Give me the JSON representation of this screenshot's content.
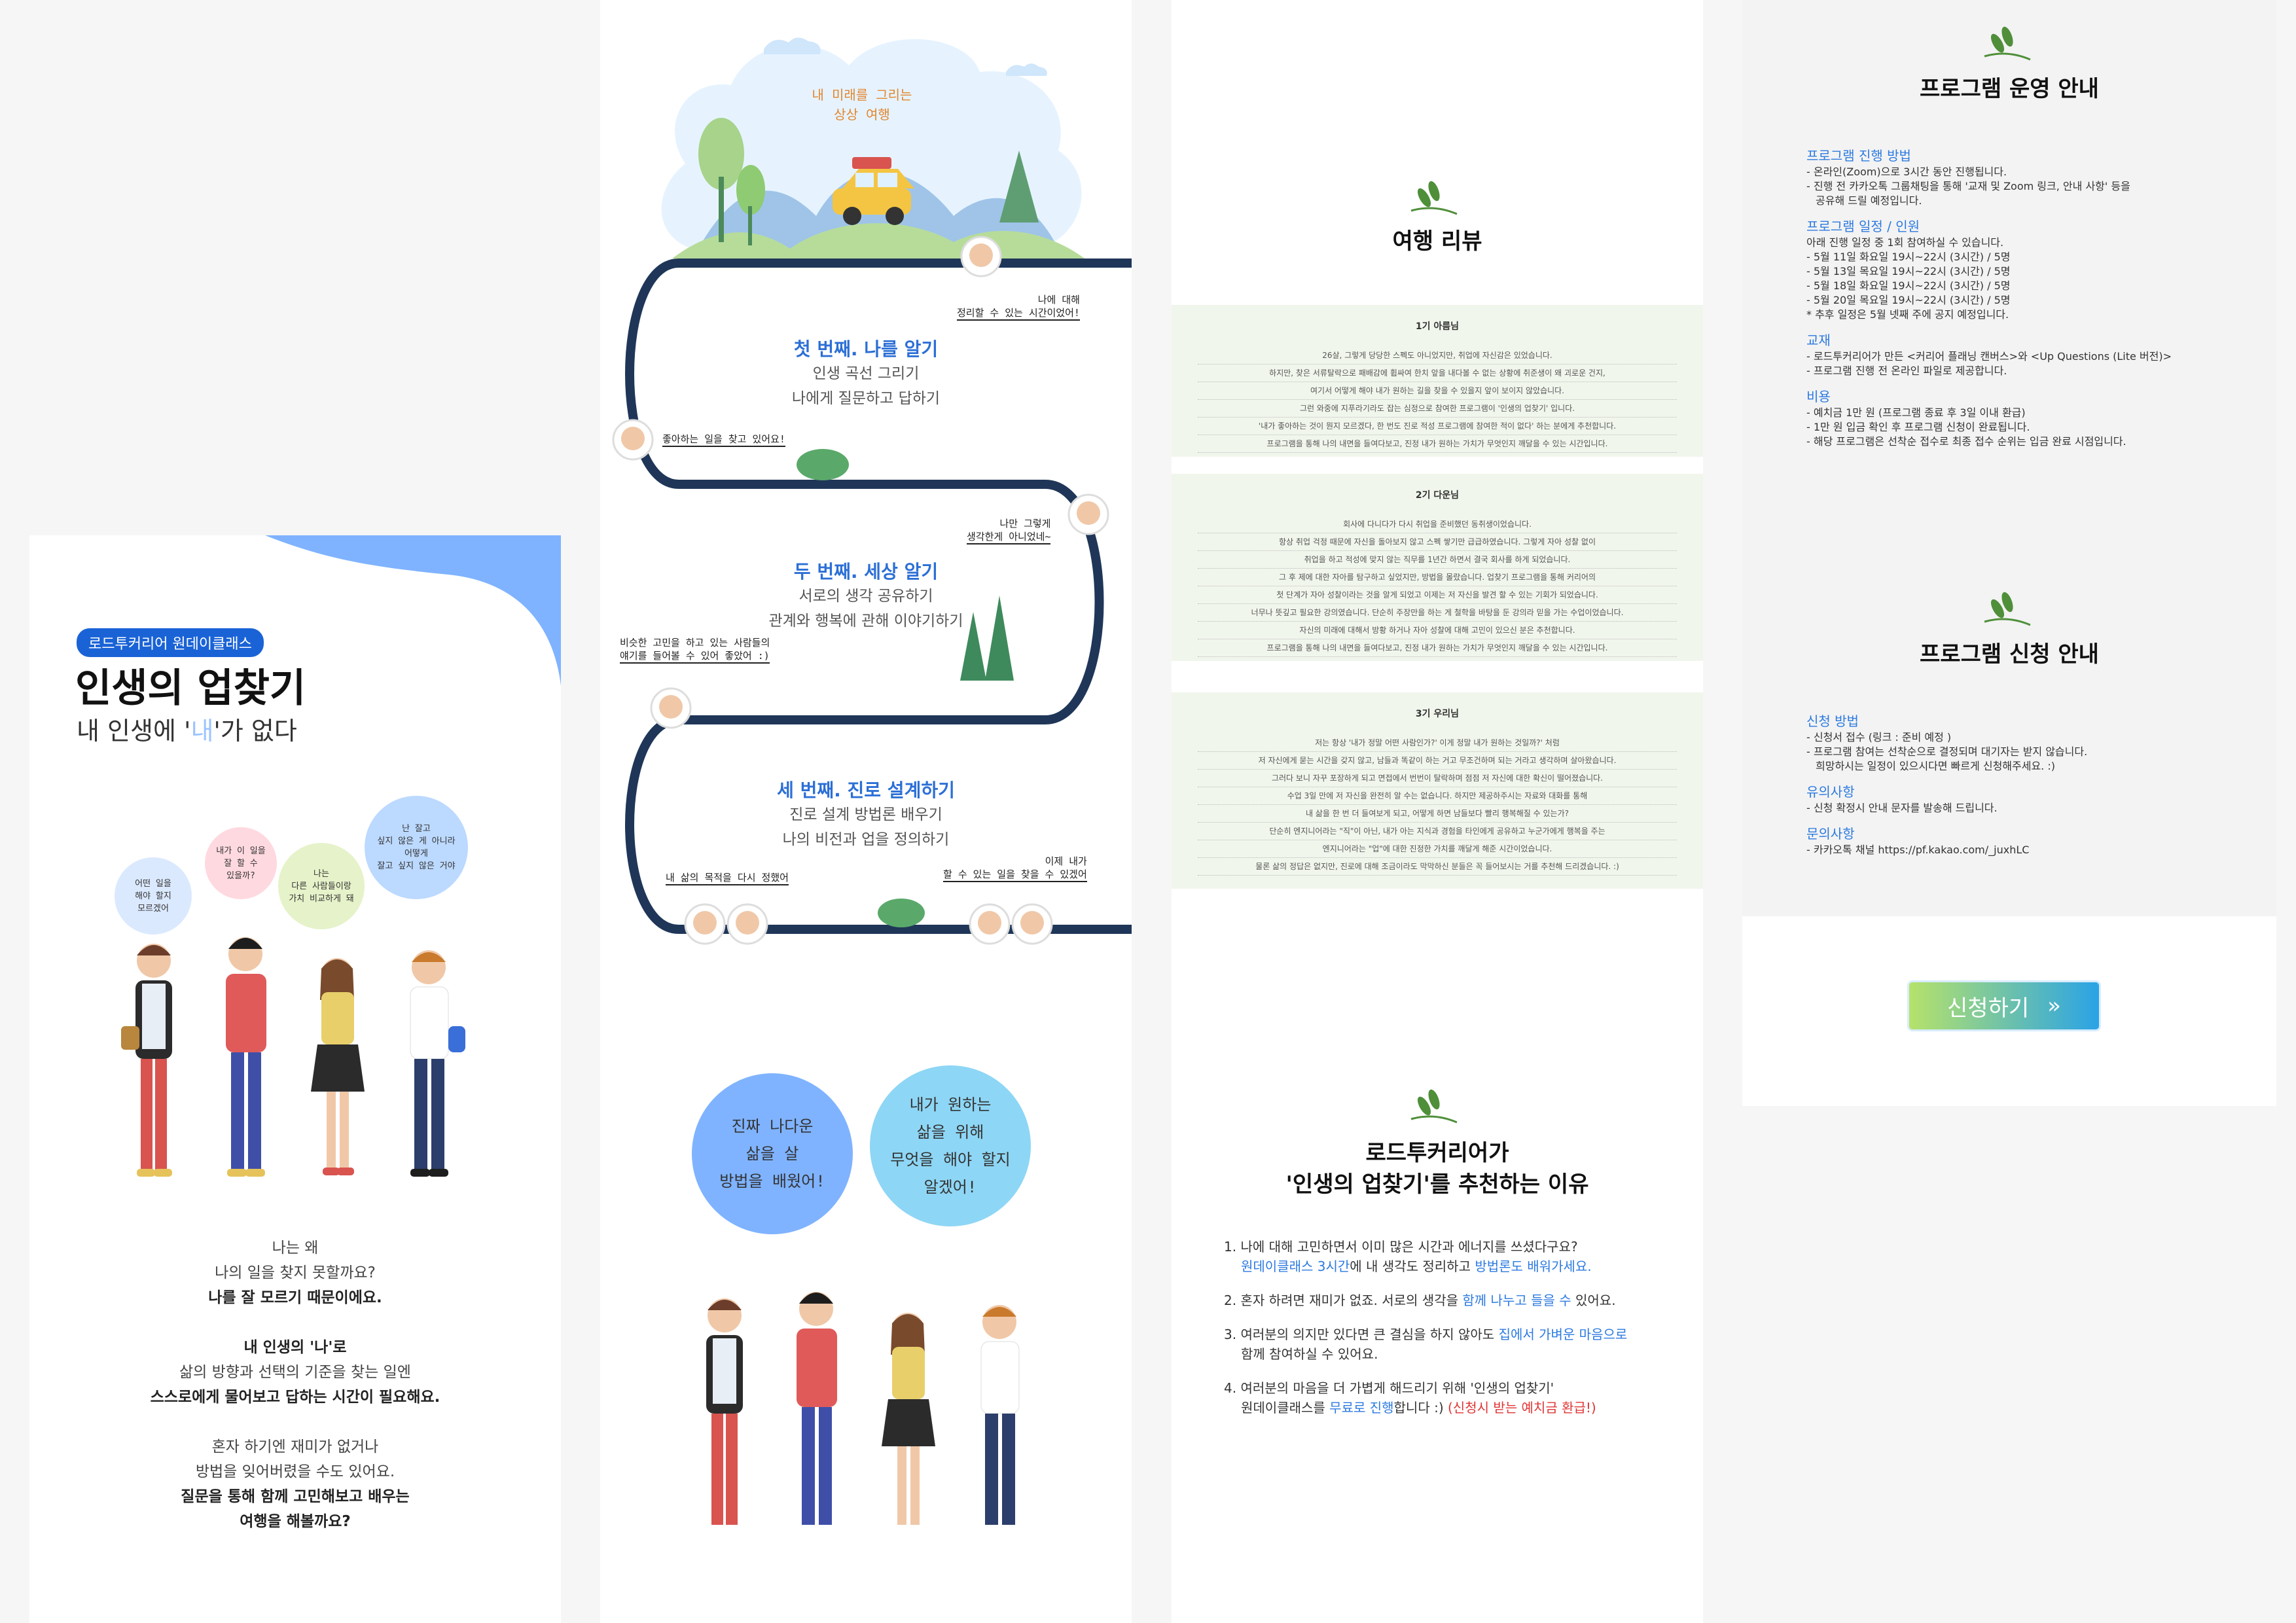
{
  "panel1": {
    "badge": "로드투커리어 원데이클래스",
    "title": "인생의 업찾기",
    "subtitle_before": "내 인생에 '",
    "subtitle_highlight": "내",
    "subtitle_after": "'가 없다",
    "bubbles": [
      "어떤 일을\n해야 할지\n모르겠어",
      "내가 이 일을\n잘 할 수\n있을까?",
      "나는\n다른 사람들이랑\n가치 비교하게 돼",
      "난 잘고\n싶지 않은 게 아니라\n어떻게\n잘고 싶지 않은 거야"
    ],
    "block1": [
      "나는 왜",
      "나의 일을 찾지 못할까요?"
    ],
    "block1_bold": "나를 잘 모르기 때문이에요.",
    "block2_bold": "내 인생의 '나'로",
    "block2": "삶의 방향과 선택의 기준을 찾는 일엔",
    "block2_bold2": "스스로에게 물어보고 답하는 시간이 필요해요.",
    "block3": [
      "혼자 하기엔 재미가 없거나",
      "방법을 잊어버렸을 수도 있어요."
    ],
    "block3_bold": [
      "질문을 통해 함께 고민해보고 배우는",
      "여행을 해볼까요?"
    ]
  },
  "panel2": {
    "cloud_title": "내 미래를 그리는\n상상 여행",
    "step1_title": "첫 번째. 나를 알기",
    "step1_lines": [
      "인생 곡선 그리기",
      "나에게 질문하고 답하기"
    ],
    "step2_title": "두 번째. 세상 알기",
    "step2_lines": [
      "서로의 생각 공유하기",
      "관계와 행복에 관해 이야기하기"
    ],
    "step3_title": "세 번째. 진로 설계하기",
    "step3_lines": [
      "진로 설계 방법론 배우기",
      "나의 비전과 업을 정의하기"
    ],
    "notes": [
      "나에 대해\n정리할 수 있는 시간이었어!",
      "좋아하는 일을 찾고 있어요!",
      "나만 그렇게\n생각한게 아니었네~",
      "비슷한 고민을 하고 있는 사람들의\n얘기를 들어볼 수 있어 좋았어 :)",
      "내 삶의 목적을 다시 정했어",
      "이제 내가\n할 수 있는 일을 찾을 수 있겠어"
    ],
    "bubble_left": "진짜 나다운\n삶을 살\n방법을 배웠어!",
    "bubble_right": "내가 원하는\n삶을 위해\n무엇을 해야 할지\n알겠어!"
  },
  "panel3": {
    "review_title": "여행 리뷰",
    "reviews": [
      {
        "name": "1기 아름님",
        "lines": [
          "26살, 그렇게 당당한 스펙도 아니었지만, 취업에 자신감은 있었습니다.",
          "하지만, 찾은 서류탈락으로 패배감에 휩싸여 한치 앞을 내다볼 수 없는 상황에 취준생이 왜 괴로운 건지,",
          "여기서 어떻게 해야 내가 원하는 길을 찾을 수 있을지 앞이 보이지 않았습니다.",
          "그런 와중에 지푸라기라도 잡는 심정으로 참여한 프로그램이 '인생의 업찾기' 입니다.",
          "'내가 좋아하는 것이 뭔지 모르겠다, 한 번도 진로 적성 프로그램에 참여한 적이 없다' 하는 분에게 추천합니다.",
          "프로그램을 통해 나의 내면을 들여다보고, 진정 내가 원하는 가치가 무엇인지 깨달을 수 있는 시간입니다."
        ]
      },
      {
        "name": "2기 다운님",
        "lines": [
          "회사에 다니다가 다시 취업을 준비했던 동취생이었습니다.",
          "항상 취업 걱정 때문에 자신을 돌아보지 않고 스펙 쌓기만 급급하였습니다. 그렇게 자아 성찰 없이",
          "취업을 하고 적성에 맞지 않는 직무를 1년간 하면서 결국 회사를 하게 되었습니다.",
          "그 후 제에 대한 자아를 탐구하고 싶었지만, 방법을 몰랐습니다. 업찾기 프로그램을 통해 커리어의",
          "첫 단계가 자아 성찰이라는 것을 알게 되었고 이제는 저 자신을 발견 할 수 있는 기회가 되었습니다.",
          "너무나 뜻깊고 필요한 강의였습니다. 단순히 주장만을 하는 게 철학을 바탕을 둔 강의라 믿을 가는 수업이었습니다.",
          "자신의 미래에 대해서 방황 하거나 자아 성찰에 대해 고민이 있으신 분은 추천합니다.",
          "프로그램을 통해 나의 내면을 들여다보고, 진정 내가 원하는 가치가 무엇인지 깨달을 수 있는 시간입니다."
        ]
      },
      {
        "name": "3기 우리님",
        "lines": [
          "저는 항상 '내가 정말 어떤 사람인가?' 이게 정말 내가 원하는 것일까?' 처럼",
          "저 자신에게 묻는 시간을 갖지 않고, 남들과 똑같이 하는 거고 무조건하며 되는 거라고 생각하며 살아왔습니다.",
          "그러다 보니 자꾸 포장하게 되고 면접에서 번번이 탈락하며 점점 저 자신에 대한 확신이 떨어졌습니다.",
          "수업 3일 만에 저 자신을 완전히 알 수는 없습니다. 하지만 제공하주시는 자료와 대화를 통해",
          "내 삶을 한 번 더 들여보게 되고, 어떻게 하면 남들보다 빨리 행복해질 수 있는가?",
          "단순히 엔지니어라는 \"직\"이 아닌, 내가 아는 지식과 경험을 타인에게 공유하고 누군가에게 행복을 주는",
          "엔지니어라는 \"업\"에 대한 진정한 가치를 깨달게 해준 시간이었습니다.",
          "물론 삶의 정답은 없지만, 진로에 대해 조금이라도 막막하신 분들은 꼭 들어보시는 거를 추천해 드리겠습니다. :)"
        ]
      }
    ],
    "recommend_title": "로드투커리어가\n'인생의 업찾기'를 추천하는 이유",
    "reasons": [
      {
        "num": "1.",
        "a": "나에 대해 고민하면서 이미 많은 시간과 에너지를 쓰셨다구요?",
        "b_blue": "원데이클래스 3시간",
        "b_mid": "에 내 생각도 정리하고 ",
        "b_blue2": "방법론도 배워가세요."
      },
      {
        "num": "2.",
        "a": "혼자 하려면 재미가 없죠. 서로의 생각을 ",
        "a_blue": "함께 나누고 들을 수",
        "a_end": " 있어요."
      },
      {
        "num": "3.",
        "a": "여러분의 의지만 있다면 큰 결심을 하지 않아도 ",
        "a_blue": "집에서 가벼운 마음으로",
        "b": "함께 참여하실 수 있어요."
      },
      {
        "num": "4.",
        "a": "여러분의 마음을 더 가볍게 해드리기 위해 '인생의 업찾기'",
        "b_pre": "원데이클래스를 ",
        "b_blue": "무료로 진행",
        "b_mid": "합니다 :) ",
        "b_red": "(신청시 받는 예치금 환급!)"
      }
    ]
  },
  "panel4": {
    "ops_title": "프로그램 운영 안내",
    "ops": [
      {
        "h": "프로그램 진행 방법",
        "lines": [
          "- 온라인(Zoom)으로 3시간 동안 진행됩니다.",
          "- 진행 전 카카오톡 그룹채팅을 통해 '교재 및 Zoom 링크, 안내 사항' 등을",
          "   공유해 드릴 예정입니다."
        ]
      },
      {
        "h": "프로그램 일정 / 인원",
        "lines": [
          "아래 진행 일정 중 1회 참여하실 수 있습니다.",
          "- 5월 11일 화요일 19시~22시 (3시간) / 5명",
          "- 5월 13일 목요일 19시~22시 (3시간) / 5명",
          "- 5월 18일 화요일 19시~22시 (3시간) / 5명",
          "- 5월 20일 목요일 19시~22시 (3시간) / 5명",
          "* 추후 일정은 5월 넷째 주에 공지 예정입니다."
        ]
      },
      {
        "h": "교재",
        "lines": [
          "- 로드투커리어가 만든 <커리어 플래닝 캔버스>와 <Up Questions (Lite 버전)>",
          "- 프로그램 진행 전 온라인 파일로 제공합니다."
        ]
      },
      {
        "h": "비용",
        "lines": [
          "- 예치금 1만 원 (프로그램 종료 후 3일 이내 환급)",
          "- 1만 원 입금 확인 후 프로그램 신청이 완료됩니다.",
          "- 해당 프로그램은 선착순 접수로 최종 접수 순위는 입금 완료 시점입니다."
        ]
      }
    ],
    "apply_title": "프로그램 신청 안내",
    "apply": [
      {
        "h": "신청 방법",
        "lines": [
          "- 신청서 접수 (링크 : 준비 예정 )",
          "- 프로그램 참여는 선착순으로 결정되며 대기자는 받지 않습니다.",
          "   희망하시는 일정이 있으시다면 빠르게 신청해주세요. :)"
        ]
      },
      {
        "h": "유의사항",
        "lines": [
          "- 신청 확정시 안내 문자를 발송해 드립니다."
        ]
      },
      {
        "h": "문의사항",
        "lines": [
          "- 카카오톡 채널 https://pf.kakao.com/_juxhLC"
        ]
      }
    ],
    "apply_button": "신청하기",
    "apply_button_icon": "»"
  },
  "colors": {
    "accent_blue": "#2c7ae0",
    "badge_blue": "#1a63d6",
    "road": "#1f3658",
    "review_bg": "#f1f6ec"
  }
}
